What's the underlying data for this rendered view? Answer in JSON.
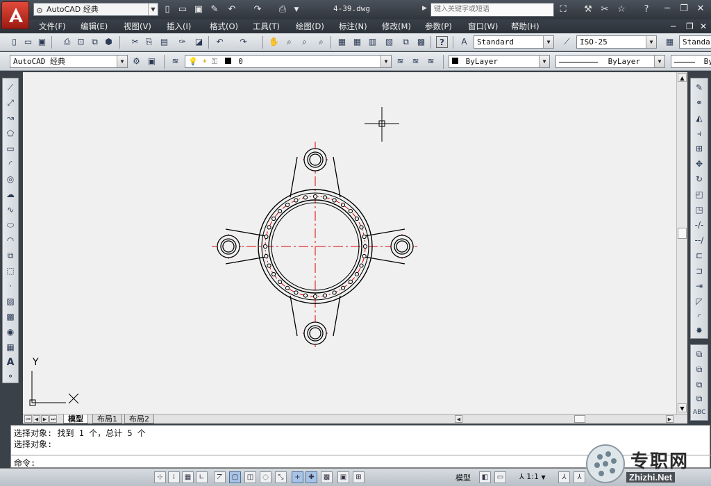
{
  "title_bar": {
    "workspace": "AutoCAD 经典",
    "document": "4-39.dwg",
    "search_placeholder": "键入关键字或短语"
  },
  "menu": [
    "文件(F)",
    "编辑(E)",
    "视图(V)",
    "插入(I)",
    "格式(O)",
    "工具(T)",
    "绘图(D)",
    "标注(N)",
    "修改(M)",
    "参数(P)",
    "窗口(W)",
    "帮助(H)"
  ],
  "styles": {
    "text_style": "Standard",
    "dim_style": "ISO-25",
    "table_style": "Standar"
  },
  "layers": {
    "workspace": "AutoCAD 经典",
    "current_layer": "0",
    "color": "ByLayer",
    "linetype": "ByLayer",
    "lineweight": "By"
  },
  "ucs": {
    "y_label": "Y",
    "x_label": "X"
  },
  "tabs": [
    "模型",
    "布局1",
    "布局2"
  ],
  "command": {
    "history": [
      "选择对象: 找到 1 个，总计 5 个",
      "选择对象:"
    ],
    "prompt": "命令:"
  },
  "status": {
    "space": "模型",
    "scale": "1:1"
  },
  "watermark": {
    "brand": "专职网",
    "url": "Zhizhi.Net"
  },
  "colors": {
    "centerline": "#e00000",
    "geometry": "#000000",
    "canvas": "#f0f0f0"
  }
}
